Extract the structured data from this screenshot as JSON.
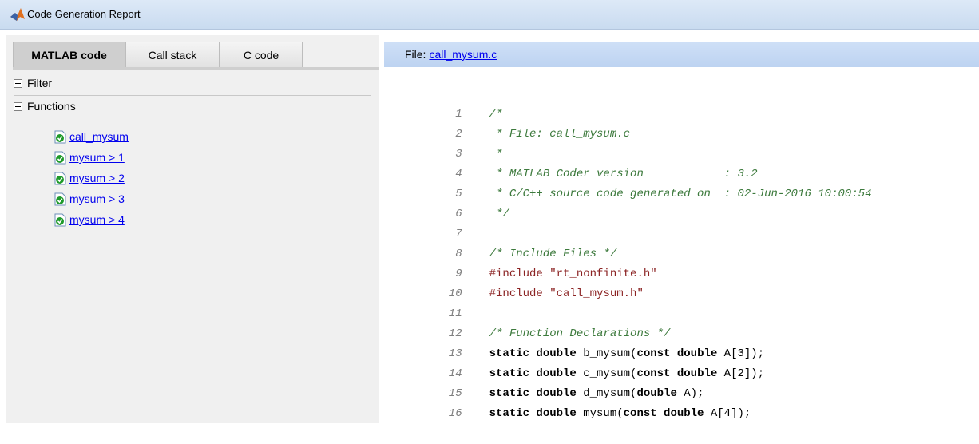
{
  "window": {
    "title": "Code Generation Report"
  },
  "tabs": [
    {
      "label": "MATLAB code",
      "active": true
    },
    {
      "label": "Call stack",
      "active": false
    },
    {
      "label": "C code",
      "active": false
    }
  ],
  "sections": {
    "filter": {
      "label": "Filter",
      "expanded": false
    },
    "functions": {
      "label": "Functions",
      "expanded": true
    }
  },
  "functions": [
    {
      "label": "call_mysum"
    },
    {
      "label": "mysum > 1"
    },
    {
      "label": "mysum > 2"
    },
    {
      "label": "mysum > 3"
    },
    {
      "label": "mysum > 4"
    }
  ],
  "file_header": {
    "prefix": "File:",
    "filename": "call_mysum.c"
  },
  "code_lines": [
    {
      "n": "1",
      "type": "comment",
      "text": "/*"
    },
    {
      "n": "2",
      "type": "comment",
      "text": " * File: call_mysum.c"
    },
    {
      "n": "3",
      "type": "comment",
      "text": " *"
    },
    {
      "n": "4",
      "type": "comment",
      "text": " * MATLAB Coder version            : 3.2"
    },
    {
      "n": "5",
      "type": "comment",
      "text": " * C/C++ source code generated on  : 02-Jun-2016 10:00:54"
    },
    {
      "n": "6",
      "type": "comment",
      "text": " */"
    },
    {
      "n": "7",
      "type": "blank",
      "text": ""
    },
    {
      "n": "8",
      "type": "comment",
      "text": "/* Include Files */"
    },
    {
      "n": "9",
      "type": "include",
      "kw": "#include",
      "rest": " \"rt_nonfinite.h\""
    },
    {
      "n": "10",
      "type": "include",
      "kw": "#include",
      "rest": " \"call_mysum.h\""
    },
    {
      "n": "11",
      "type": "blank",
      "text": ""
    },
    {
      "n": "12",
      "type": "comment",
      "text": "/* Function Declarations */"
    },
    {
      "n": "13",
      "type": "decl",
      "kw": "static double",
      "rest": " b_mysum(",
      "kw2": "const double",
      "rest2": " A[3]);"
    },
    {
      "n": "14",
      "type": "decl",
      "kw": "static double",
      "rest": " c_mysum(",
      "kw2": "const double",
      "rest2": " A[2]);"
    },
    {
      "n": "15",
      "type": "decl",
      "kw": "static double",
      "rest": " d_mysum(",
      "kw2": "double",
      "rest2": " A);"
    },
    {
      "n": "16",
      "type": "decl",
      "kw": "static double",
      "rest": " mysum(",
      "kw2": "const double",
      "rest2": " A[4]);"
    }
  ],
  "colors": {
    "comment": "#3d7a3d",
    "directive": "#8b2323",
    "link": "#0000ee",
    "header_bg": "#c6d9f3",
    "check_green": "#1e9a2a"
  },
  "icons": {
    "app": "matlab-logo-icon",
    "function": "file-check-icon"
  }
}
